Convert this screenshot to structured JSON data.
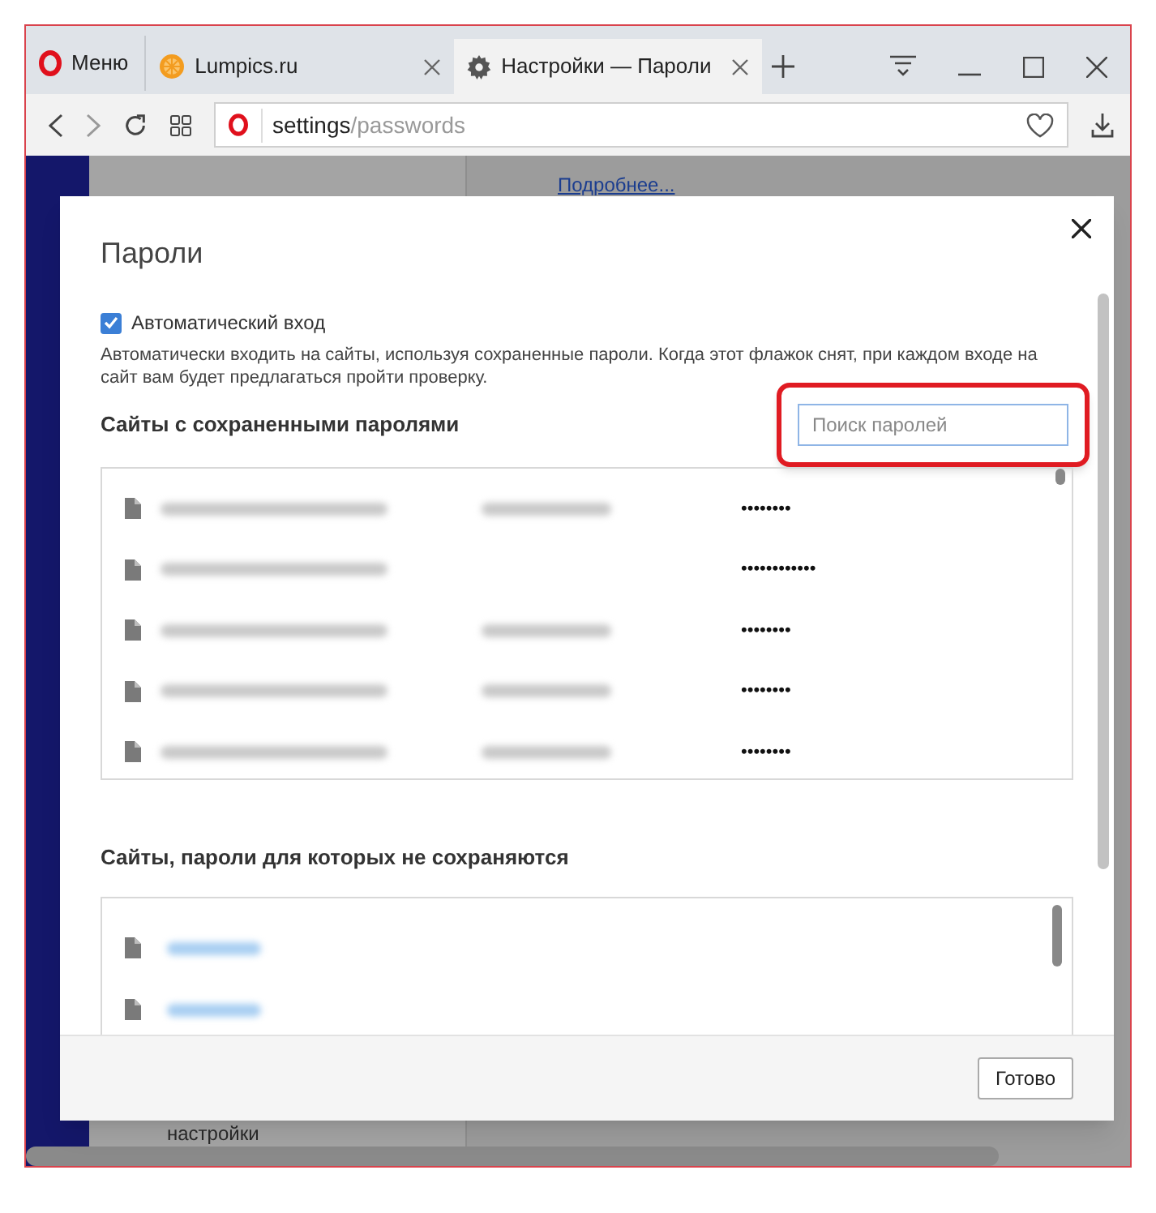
{
  "menu_button": {
    "label": "Меню"
  },
  "tabs": [
    {
      "label": "Lumpics.ru",
      "kind": "site",
      "selected": false
    },
    {
      "label": "Настройки — Пароли",
      "kind": "settings",
      "selected": true
    }
  ],
  "address": {
    "host": "settings",
    "path": "/passwords"
  },
  "background": {
    "link": "Подробнее...",
    "sidebar_text": "настройки"
  },
  "dialog": {
    "title": "Пароли",
    "auto_login": {
      "label": "Автоматический вход",
      "checked": true
    },
    "description": "Автоматически входить на сайты, используя сохраненные пароли. Когда этот флажок снят, при каждом входе на сайт вам будет предлагаться пройти проверку.",
    "saved": {
      "title": "Сайты с сохраненными паролями",
      "search": {
        "placeholder": "Поиск паролей"
      },
      "rows": [
        {
          "has_login": true,
          "password": "••••••••"
        },
        {
          "has_login": false,
          "password": "••••••••••••"
        },
        {
          "has_login": true,
          "password": "••••••••"
        },
        {
          "has_login": true,
          "password": "••••••••"
        },
        {
          "has_login": true,
          "password": "••••••••"
        }
      ]
    },
    "never_saved": {
      "title": "Сайты, пароли для которых не сохраняются",
      "rows": [
        {
          "kind": "site"
        },
        {
          "kind": "site"
        }
      ]
    },
    "done_button": "Готово"
  }
}
